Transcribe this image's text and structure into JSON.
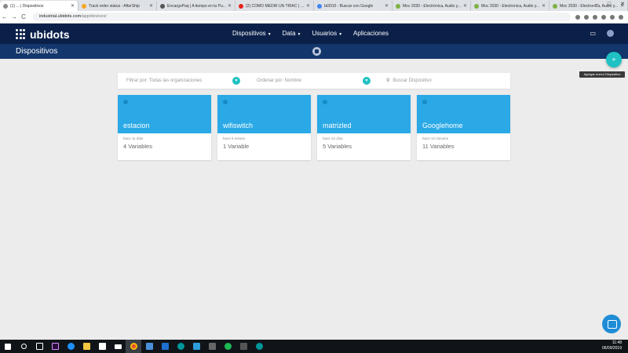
{
  "browser": {
    "tabs": [
      {
        "title": "(1) ... | Dispositivos",
        "active": true,
        "color": "#888888"
      },
      {
        "title": "Track order status - AfterShip",
        "active": false,
        "color": "#f5a623"
      },
      {
        "title": "EncargoPaq | A tiempo en tu Pu...",
        "active": false,
        "color": "#555555"
      },
      {
        "title": "(2) COMO MEDIR UN TRIAC | CO...",
        "active": false,
        "color": "#e62117"
      },
      {
        "title": "bt3010 - Buscar con Google",
        "active": false,
        "color": "#4285f4"
      },
      {
        "title": "Moc 2030 - Electrónica, Audio y...",
        "active": false,
        "color": "#7cb342"
      },
      {
        "title": "Moc 2030 - Electronica, Audio y...",
        "active": false,
        "color": "#7cb342"
      },
      {
        "title": "Moc 2030 - Electronica, Audio y...",
        "active": false,
        "color": "#7cb342"
      }
    ],
    "new_tab": "+",
    "window_controls": [
      "–",
      "□",
      "✕"
    ],
    "url_host": "industrial.ubidots.com",
    "url_path": "/app/devices/",
    "back": "←",
    "forward": "→",
    "reload": "C"
  },
  "app": {
    "logo_text": "ubidots",
    "nav": [
      {
        "label": "Dispositivos",
        "dropdown": true
      },
      {
        "label": "Data",
        "dropdown": true
      },
      {
        "label": "Usuarios",
        "dropdown": true
      },
      {
        "label": "Aplicaciones",
        "dropdown": false
      }
    ],
    "page_title": "Dispositivos",
    "fab_label": "+",
    "fab_tooltip": "Agregar nuevo Dispositivo"
  },
  "filters": {
    "org": "Filtrar por: Todas las organizaciones",
    "sort": "Ordenar por: Nombre",
    "search_placeholder": "Buscar Dispositivo"
  },
  "devices": [
    {
      "name": "estacion",
      "last_activity": "hace 11 días",
      "variables": "4 Variables"
    },
    {
      "name": "wifiswitch",
      "last_activity": "hace 8 meses",
      "variables": "1 Variable"
    },
    {
      "name": "matrizled",
      "last_activity": "hace 23 días",
      "variables": "5 Variables"
    },
    {
      "name": "Googlehome",
      "last_activity": "hace 12 minutos",
      "variables": "11 Variables"
    }
  ],
  "taskbar": {
    "time": "11:48",
    "date": "06/09/2019"
  },
  "colors": {
    "header": "#0b2049",
    "subheader": "#13376d",
    "accent": "#1fc1c2",
    "card": "#2aa9e6"
  }
}
